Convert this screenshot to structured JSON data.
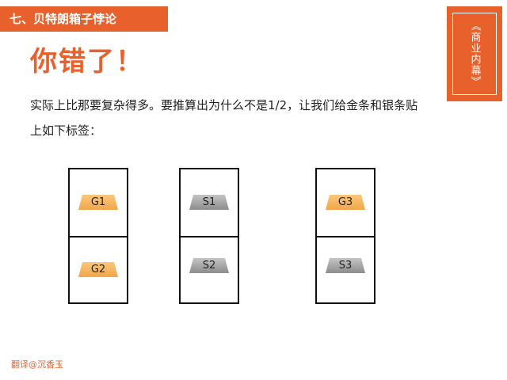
{
  "header": {
    "title": "七、贝特朗箱子悖论"
  },
  "side_tab": {
    "label": "《商业内幕》"
  },
  "slide": {
    "heading": "你错了！",
    "paragraph": "实际上比那要复杂得多。要推算出为什么不是1/2，让我们给金条和银条贴上如下标签："
  },
  "boxes": [
    {
      "top_label": "G1",
      "bottom_label": "G2",
      "top_kind": "gold",
      "bottom_kind": "gold"
    },
    {
      "top_label": "S1",
      "bottom_label": "S2",
      "top_kind": "silver",
      "bottom_kind": "silver"
    },
    {
      "top_label": "G3",
      "bottom_label": "S3",
      "top_kind": "gold",
      "bottom_kind": "silver"
    }
  ],
  "footer": {
    "credit": "翻译@沉香玉"
  },
  "colors": {
    "accent": "#e8612c",
    "gold": "#f2a64a",
    "silver": "#9a9a9a"
  }
}
